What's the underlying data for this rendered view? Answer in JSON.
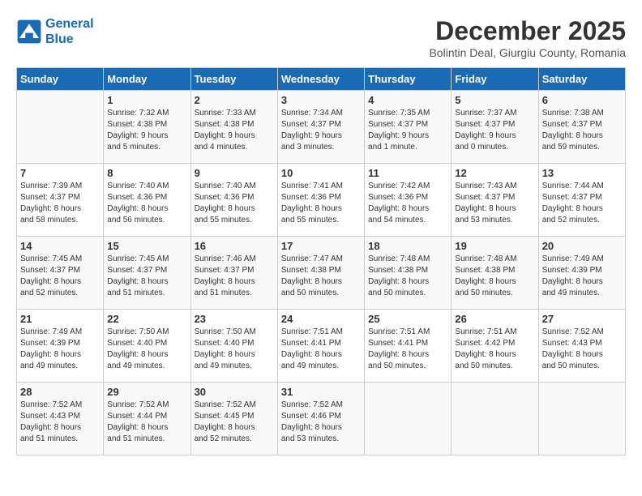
{
  "logo": {
    "line1": "General",
    "line2": "Blue"
  },
  "title": "December 2025",
  "subtitle": "Bolintin Deal, Giurgiu County, Romania",
  "days_of_week": [
    "Sunday",
    "Monday",
    "Tuesday",
    "Wednesday",
    "Thursday",
    "Friday",
    "Saturday"
  ],
  "weeks": [
    [
      {
        "day": "",
        "info": ""
      },
      {
        "day": "1",
        "info": "Sunrise: 7:32 AM\nSunset: 4:38 PM\nDaylight: 9 hours\nand 5 minutes."
      },
      {
        "day": "2",
        "info": "Sunrise: 7:33 AM\nSunset: 4:38 PM\nDaylight: 9 hours\nand 4 minutes."
      },
      {
        "day": "3",
        "info": "Sunrise: 7:34 AM\nSunset: 4:37 PM\nDaylight: 9 hours\nand 3 minutes."
      },
      {
        "day": "4",
        "info": "Sunrise: 7:35 AM\nSunset: 4:37 PM\nDaylight: 9 hours\nand 1 minute."
      },
      {
        "day": "5",
        "info": "Sunrise: 7:37 AM\nSunset: 4:37 PM\nDaylight: 9 hours\nand 0 minutes."
      },
      {
        "day": "6",
        "info": "Sunrise: 7:38 AM\nSunset: 4:37 PM\nDaylight: 8 hours\nand 59 minutes."
      }
    ],
    [
      {
        "day": "7",
        "info": "Sunrise: 7:39 AM\nSunset: 4:37 PM\nDaylight: 8 hours\nand 58 minutes."
      },
      {
        "day": "8",
        "info": "Sunrise: 7:40 AM\nSunset: 4:36 PM\nDaylight: 8 hours\nand 56 minutes."
      },
      {
        "day": "9",
        "info": "Sunrise: 7:40 AM\nSunset: 4:36 PM\nDaylight: 8 hours\nand 55 minutes."
      },
      {
        "day": "10",
        "info": "Sunrise: 7:41 AM\nSunset: 4:36 PM\nDaylight: 8 hours\nand 55 minutes."
      },
      {
        "day": "11",
        "info": "Sunrise: 7:42 AM\nSunset: 4:36 PM\nDaylight: 8 hours\nand 54 minutes."
      },
      {
        "day": "12",
        "info": "Sunrise: 7:43 AM\nSunset: 4:37 PM\nDaylight: 8 hours\nand 53 minutes."
      },
      {
        "day": "13",
        "info": "Sunrise: 7:44 AM\nSunset: 4:37 PM\nDaylight: 8 hours\nand 52 minutes."
      }
    ],
    [
      {
        "day": "14",
        "info": "Sunrise: 7:45 AM\nSunset: 4:37 PM\nDaylight: 8 hours\nand 52 minutes."
      },
      {
        "day": "15",
        "info": "Sunrise: 7:45 AM\nSunset: 4:37 PM\nDaylight: 8 hours\nand 51 minutes."
      },
      {
        "day": "16",
        "info": "Sunrise: 7:46 AM\nSunset: 4:37 PM\nDaylight: 8 hours\nand 51 minutes."
      },
      {
        "day": "17",
        "info": "Sunrise: 7:47 AM\nSunset: 4:38 PM\nDaylight: 8 hours\nand 50 minutes."
      },
      {
        "day": "18",
        "info": "Sunrise: 7:48 AM\nSunset: 4:38 PM\nDaylight: 8 hours\nand 50 minutes."
      },
      {
        "day": "19",
        "info": "Sunrise: 7:48 AM\nSunset: 4:38 PM\nDaylight: 8 hours\nand 50 minutes."
      },
      {
        "day": "20",
        "info": "Sunrise: 7:49 AM\nSunset: 4:39 PM\nDaylight: 8 hours\nand 49 minutes."
      }
    ],
    [
      {
        "day": "21",
        "info": "Sunrise: 7:49 AM\nSunset: 4:39 PM\nDaylight: 8 hours\nand 49 minutes."
      },
      {
        "day": "22",
        "info": "Sunrise: 7:50 AM\nSunset: 4:40 PM\nDaylight: 8 hours\nand 49 minutes."
      },
      {
        "day": "23",
        "info": "Sunrise: 7:50 AM\nSunset: 4:40 PM\nDaylight: 8 hours\nand 49 minutes."
      },
      {
        "day": "24",
        "info": "Sunrise: 7:51 AM\nSunset: 4:41 PM\nDaylight: 8 hours\nand 49 minutes."
      },
      {
        "day": "25",
        "info": "Sunrise: 7:51 AM\nSunset: 4:41 PM\nDaylight: 8 hours\nand 50 minutes."
      },
      {
        "day": "26",
        "info": "Sunrise: 7:51 AM\nSunset: 4:42 PM\nDaylight: 8 hours\nand 50 minutes."
      },
      {
        "day": "27",
        "info": "Sunrise: 7:52 AM\nSunset: 4:43 PM\nDaylight: 8 hours\nand 50 minutes."
      }
    ],
    [
      {
        "day": "28",
        "info": "Sunrise: 7:52 AM\nSunset: 4:43 PM\nDaylight: 8 hours\nand 51 minutes."
      },
      {
        "day": "29",
        "info": "Sunrise: 7:52 AM\nSunset: 4:44 PM\nDaylight: 8 hours\nand 51 minutes."
      },
      {
        "day": "30",
        "info": "Sunrise: 7:52 AM\nSunset: 4:45 PM\nDaylight: 8 hours\nand 52 minutes."
      },
      {
        "day": "31",
        "info": "Sunrise: 7:52 AM\nSunset: 4:46 PM\nDaylight: 8 hours\nand 53 minutes."
      },
      {
        "day": "",
        "info": ""
      },
      {
        "day": "",
        "info": ""
      },
      {
        "day": "",
        "info": ""
      }
    ]
  ]
}
